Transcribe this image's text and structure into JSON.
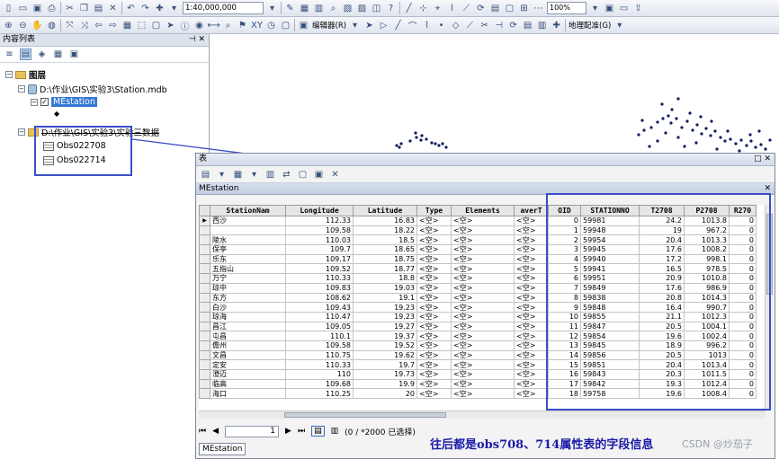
{
  "toolbar": {
    "scale_value": "1:40,000,000",
    "zoom_value": "100%",
    "editor_label": "编辑器(R)",
    "georef_label": "地理配准(G)"
  },
  "toc": {
    "title": "内容列表",
    "layers_root": "图层",
    "db_path": "D:\\作业\\GIS\\实验3\\Station.mdb",
    "layer_selected": "MEstation",
    "folder_path": "D:\\作业\\GIS\\实验3\\实验三数据",
    "tables": [
      "Obs022708",
      "Obs022714"
    ]
  },
  "table_window": {
    "title": "表",
    "table_name": "MEstation",
    "record_position": "1",
    "status_text": "(0 / *2000 已选择)",
    "bottom_tab": "MEstation"
  },
  "columns": [
    "StationNam",
    "Longitude",
    "Latitude",
    "Type",
    "Elements",
    "averT",
    "OID",
    "STATIONNO",
    "T2708",
    "P2708",
    "R270"
  ],
  "rows": [
    [
      "西沙",
      "112.33",
      "16.83",
      "<空>",
      "<空>",
      "<空>",
      "0",
      "59981",
      "24.2",
      "1013.8",
      "0"
    ],
    [
      "",
      "109.58",
      "18.22",
      "<空>",
      "<空>",
      "<空>",
      "1",
      "59948",
      "19",
      "967.2",
      "0"
    ],
    [
      "陵水",
      "110.03",
      "18.5",
      "<空>",
      "<空>",
      "<空>",
      "2",
      "59954",
      "20.4",
      "1013.3",
      "0"
    ],
    [
      "保亭",
      "109.7",
      "18.65",
      "<空>",
      "<空>",
      "<空>",
      "3",
      "59945",
      "17.6",
      "1008.2",
      "0"
    ],
    [
      "乐东",
      "109.17",
      "18.75",
      "<空>",
      "<空>",
      "<空>",
      "4",
      "59940",
      "17.2",
      "998.1",
      "0"
    ],
    [
      "五指山",
      "109.52",
      "18.77",
      "<空>",
      "<空>",
      "<空>",
      "5",
      "59941",
      "16.5",
      "978.5",
      "0"
    ],
    [
      "万宁",
      "110.33",
      "18.8",
      "<空>",
      "<空>",
      "<空>",
      "6",
      "59951",
      "20.9",
      "1010.8",
      "0"
    ],
    [
      "琼中",
      "109.83",
      "19.03",
      "<空>",
      "<空>",
      "<空>",
      "7",
      "59849",
      "17.6",
      "986.9",
      "0"
    ],
    [
      "东方",
      "108.62",
      "19.1",
      "<空>",
      "<空>",
      "<空>",
      "8",
      "59838",
      "20.8",
      "1014.3",
      "0"
    ],
    [
      "白沙",
      "109.43",
      "19.23",
      "<空>",
      "<空>",
      "<空>",
      "9",
      "59848",
      "16.4",
      "990.7",
      "0"
    ],
    [
      "琼海",
      "110.47",
      "19.23",
      "<空>",
      "<空>",
      "<空>",
      "10",
      "59855",
      "21.1",
      "1012.3",
      "0"
    ],
    [
      "昌江",
      "109.05",
      "19.27",
      "<空>",
      "<空>",
      "<空>",
      "11",
      "59847",
      "20.5",
      "1004.1",
      "0"
    ],
    [
      "屯昌",
      "110.1",
      "19.37",
      "<空>",
      "<空>",
      "<空>",
      "12",
      "59854",
      "19.6",
      "1002.4",
      "0"
    ],
    [
      "儋州",
      "109.58",
      "19.52",
      "<空>",
      "<空>",
      "<空>",
      "13",
      "59845",
      "18.9",
      "996.2",
      "0"
    ],
    [
      "文昌",
      "110.75",
      "19.62",
      "<空>",
      "<空>",
      "<空>",
      "14",
      "59856",
      "20.5",
      "1013",
      "0"
    ],
    [
      "定安",
      "110.33",
      "19.7",
      "<空>",
      "<空>",
      "<空>",
      "15",
      "59851",
      "20.4",
      "1013.4",
      "0"
    ],
    [
      "澄迈",
      "110",
      "19.73",
      "<空>",
      "<空>",
      "<空>",
      "16",
      "59843",
      "20.3",
      "1011.5",
      "0"
    ],
    [
      "临高",
      "109.68",
      "19.9",
      "<空>",
      "<空>",
      "<空>",
      "17",
      "59842",
      "19.3",
      "1012.4",
      "0"
    ],
    [
      "海口",
      "110.25",
      "20",
      "<空>",
      "<空>",
      "<空>",
      "18",
      "59758",
      "19.6",
      "1008.4",
      "0"
    ]
  ],
  "annotation": "往后都是obs708、714属性表的字段信息",
  "watermark": "CSDN @炒茄子"
}
